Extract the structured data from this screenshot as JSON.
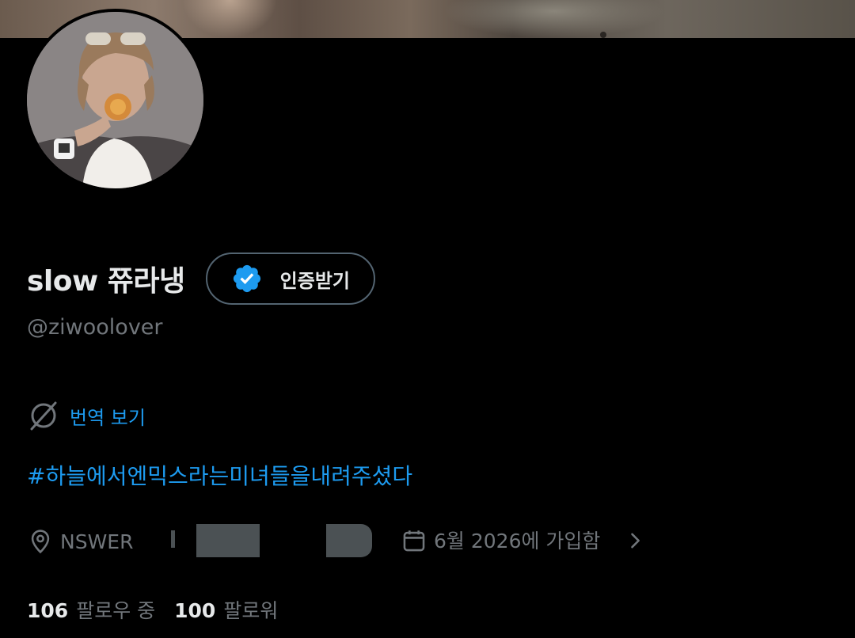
{
  "profile": {
    "display_name": "slow 쮸라냉",
    "handle": "@ziwoolover",
    "verify_button_label": "인증받기",
    "translate_label": "번역 보기",
    "bio": "#하늘에서엔믹스라는미녀들을내려주셨다",
    "location": "NSWER",
    "joined": "6월 2026에 가입함",
    "following_count": "106",
    "following_label": "팔로우 중",
    "followers_count": "100",
    "followers_label": "팔로워"
  },
  "icons": {
    "verified": "verified-badge-icon",
    "translate": "translate-icon",
    "location": "location-pin-icon",
    "calendar": "calendar-icon",
    "chevron": "chevron-right-icon"
  },
  "colors": {
    "background": "#000000",
    "text_primary": "#e7e9ea",
    "text_secondary": "#71767b",
    "accent": "#1d9bf0",
    "border": "#536471"
  }
}
